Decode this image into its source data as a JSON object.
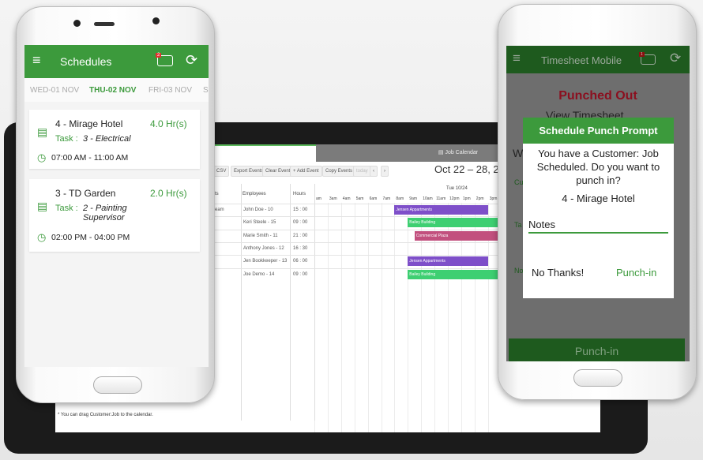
{
  "tablet": {
    "tab_right": "Job Calendar",
    "toolbar": [
      "CSV",
      "Export Events",
      "Clear Events",
      "+ Add Event",
      "Copy Events",
      "today"
    ],
    "date_range": "Oct 22 – 28, 2017",
    "columns": {
      "partial": "ts",
      "employees": "Employees",
      "hours": "Hours"
    },
    "day_header": "Tue 10/24",
    "hour_labels": [
      "am",
      "3am",
      "4am",
      "5am",
      "6am",
      "7am",
      "8am",
      "9am",
      "10am",
      "11am",
      "12pm",
      "1pm",
      "2pm",
      "3pm"
    ],
    "rows": [
      {
        "partial": "eam",
        "employee": "John Doe - 10",
        "hours": "15 : 00"
      },
      {
        "partial": "",
        "employee": "Keri Steele - 15",
        "hours": "09 : 00"
      },
      {
        "partial": "",
        "employee": "Marie Smith - 11",
        "hours": "21 : 00"
      },
      {
        "partial": "",
        "employee": "Anthony Jones - 12",
        "hours": "16 : 30"
      },
      {
        "partial": "",
        "employee": "Jen Bookkeeper - 13",
        "hours": "06 : 00"
      },
      {
        "partial": "",
        "employee": "Joe Demo - 14",
        "hours": "09 : 00"
      }
    ],
    "events": [
      {
        "row": 0,
        "label": "Jensen Appartments",
        "start": 8,
        "end": 15,
        "color": "#7e4fc9"
      },
      {
        "row": 1,
        "label": "Bailey Building",
        "start": 9,
        "end": 16,
        "color": "#3ecf72"
      },
      {
        "row": 2,
        "label": "Commercial Plaza",
        "start": 9.5,
        "end": 16,
        "color": "#c2507e"
      },
      {
        "row": 4,
        "label": "Jensen Appartments",
        "start": 9,
        "end": 15,
        "color": "#7e4fc9"
      },
      {
        "row": 5,
        "label": "Bailey Building",
        "start": 9,
        "end": 16,
        "color": "#3ecf72"
      }
    ],
    "note": "* You can drag Customer:Job to the calendar."
  },
  "left_phone": {
    "title": "Schedules",
    "badge": "2",
    "days": [
      "WED-01 NOV",
      "THU-02 NOV",
      "FRI-03 NOV",
      "S"
    ],
    "active_day": 1,
    "schedules": [
      {
        "job": "4 - Mirage Hotel",
        "hours": "4.0 Hr(s)",
        "task_label": "Task :",
        "task": "3 - Electrical",
        "time": "07:00 AM - 11:00 AM"
      },
      {
        "job": "3 - TD Garden",
        "hours": "2.0 Hr(s)",
        "task_label": "Task :",
        "task": "2 - Painting Supervisor",
        "time": "02:00 PM - 04:00 PM"
      }
    ]
  },
  "right_phone": {
    "title": "Timesheet Mobile",
    "badge": "1",
    "status": "Punched Out",
    "view_timesheet": "View Timesheet",
    "bg_labels": [
      "W",
      "Cu",
      "Ta",
      "No"
    ],
    "dialog": {
      "title": "Schedule Punch Prompt",
      "message": "You have a Customer: Job Scheduled. Do you want to punch in?",
      "job": "4 - Mirage Hotel",
      "notes_placeholder": "Notes",
      "cancel": "No Thanks!",
      "confirm": "Punch-in"
    },
    "punch_button": "Punch-in"
  },
  "colors": {
    "green": "#3c9a3c",
    "dark_green": "#1e5a1e",
    "red": "#8b0f1f"
  }
}
